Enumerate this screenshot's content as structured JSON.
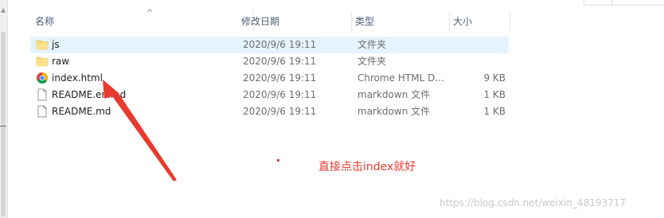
{
  "columns": {
    "name": "名称",
    "date": "修改日期",
    "type": "类型",
    "size": "大小"
  },
  "files": [
    {
      "name": "js",
      "date": "2020/9/6 19:11",
      "type": "文件夹",
      "size": "",
      "icon": "folder-icon",
      "selected": true
    },
    {
      "name": "raw",
      "date": "2020/9/6 19:11",
      "type": "文件夹",
      "size": "",
      "icon": "folder-icon",
      "selected": false
    },
    {
      "name": "index.html",
      "date": "2020/9/6 19:11",
      "type": "Chrome HTML D...",
      "size": "9 KB",
      "icon": "chrome-icon",
      "selected": false
    },
    {
      "name": "README.en.md",
      "date": "2020/9/6 19:11",
      "type": "markdown 文件",
      "size": "1 KB",
      "icon": "file-icon",
      "selected": false
    },
    {
      "name": "README.md",
      "date": "2020/9/6 19:11",
      "type": "markdown 文件",
      "size": "1 KB",
      "icon": "file-icon",
      "selected": false
    }
  ],
  "annotation": {
    "text": "直接点击index就好",
    "color": "#e83a2f"
  },
  "watermark": "https://blog.csdn.net/weixin_48193717",
  "colors": {
    "selected_row": "#e5f3ff",
    "header_text": "#4c607a",
    "folder": "#f8d775"
  }
}
